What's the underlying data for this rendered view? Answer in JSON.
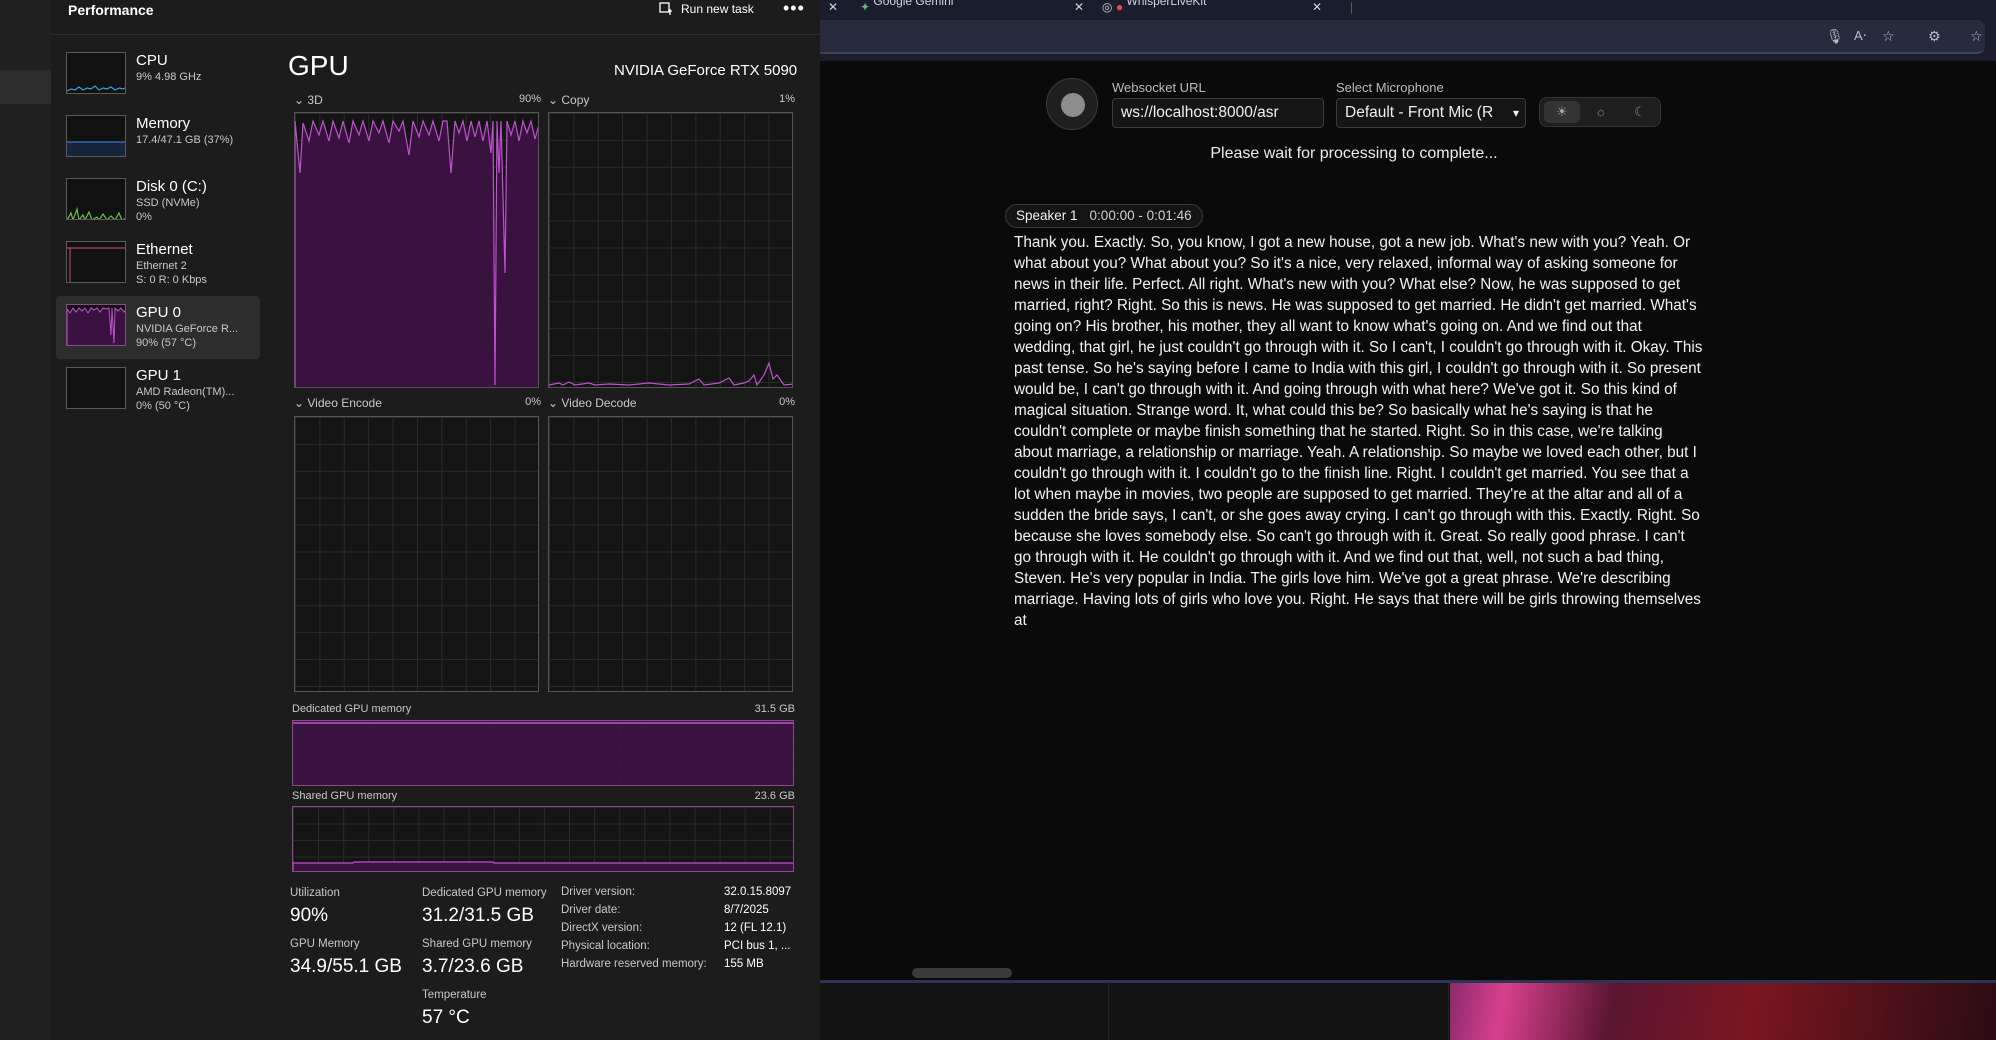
{
  "task_manager": {
    "title": "Performance",
    "run_new_task": "Run new task",
    "more": "•••",
    "sidebar": [
      {
        "name": "CPU",
        "line1": "9% 4.98 GHz",
        "line2": ""
      },
      {
        "name": "Memory",
        "line1": "17.4/47.1 GB (37%)",
        "line2": ""
      },
      {
        "name": "Disk 0 (C:)",
        "line1": "SSD (NVMe)",
        "line2": "0%"
      },
      {
        "name": "Ethernet",
        "line1": "Ethernet 2",
        "line2": "S: 0 R: 0 Kbps"
      },
      {
        "name": "GPU 0",
        "line1": "NVIDIA GeForce R...",
        "line2": "90% (57 °C)"
      },
      {
        "name": "GPU 1",
        "line1": "AMD Radeon(TM)...",
        "line2": "0% (50 °C)"
      }
    ],
    "gpu_title": "GPU",
    "gpu_model": "NVIDIA GeForce RTX 5090",
    "graphs": [
      {
        "label": "3D",
        "value": "90%"
      },
      {
        "label": "Copy",
        "value": "1%"
      },
      {
        "label": "Video Encode",
        "value": "0%"
      },
      {
        "label": "Video Decode",
        "value": "0%"
      }
    ],
    "dedicated_mem": {
      "label": "Dedicated GPU memory",
      "value": "31.5 GB"
    },
    "shared_mem": {
      "label": "Shared GPU memory",
      "value": "23.6 GB"
    },
    "stats": {
      "utilization_label": "Utilization",
      "utilization": "90%",
      "dedicated_label": "Dedicated GPU memory",
      "dedicated": "31.2/31.5 GB",
      "gpu_memory_label": "GPU Memory",
      "gpu_memory": "34.9/55.1 GB",
      "shared_label": "Shared GPU memory",
      "shared": "3.7/23.6 GB",
      "temp_label": "Temperature",
      "temp": "57 °C"
    },
    "info": [
      {
        "k": "Driver version:",
        "v": "32.0.15.8097"
      },
      {
        "k": "Driver date:",
        "v": "8/7/2025"
      },
      {
        "k": "DirectX version:",
        "v": "12 (FL 12.1)"
      },
      {
        "k": "Physical location:",
        "v": "PCI bus 1, ..."
      },
      {
        "k": "Hardware reserved memory:",
        "v": "155 MB"
      }
    ],
    "colors": {
      "gpu_line": "#c050d0",
      "gpu_fill": "#3a1240",
      "cpu_line": "#3aa0d8",
      "disk_line": "#6cc04a",
      "eth_line": "#d04a80"
    }
  },
  "browser": {
    "tabs": [
      {
        "title": "Google Gemini"
      },
      {
        "title": "WhisperLiveKit"
      }
    ],
    "app": {
      "websocket_label": "Websocket URL",
      "websocket_value": "ws://localhost:8000/asr",
      "mic_label": "Select Microphone",
      "mic_value": "Default - Front Mic (R",
      "status": "Please wait for processing to complete...",
      "speaker": "Speaker 1",
      "time_range": "0:00:00 - 0:01:46",
      "transcript": "Thank you. Exactly. So, you know, I got a new house, got a new job. What's new with you? Yeah. Or what about you? What about you? So it's a nice, very relaxed, informal way of asking someone for news in their life. Perfect. All right. What's new with you? What else? Now, he was supposed to get married, right? Right. So this is news. He was supposed to get married. He didn't get married. What's going on? His brother, his mother, they all want to know what's going on. And we find out that wedding, that girl, he just couldn't go through with it. So I can't, I couldn't go through with it. Okay. This past tense. So he's saying before I came to India with this girl, I couldn't go through with it. So present would be, I can't go through with it. And going through with what here? We've got it. So this kind of magical situation. Strange word. It, what could this be? So basically what he's saying is that he couldn't complete or maybe finish something that he started. Right. So in this case, we're talking about marriage, a relationship or marriage. Yeah. A relationship. So maybe we loved each other, but I couldn't go through with it. I couldn't go to the finish line. Right. I couldn't get married. You see that a lot when maybe in movies, two people are supposed to get married. They're at the altar and all of a sudden the bride says, I can't, or she goes away crying. I can't go through with this. Exactly. Right. So because she loves somebody else. So can't go through with it. Great. So really good phrase. I can't go through with it. He couldn't go through with it. And we find out that, well, not such a bad thing, Steven. He's very popular in India. The girls love him. We've got a great phrase. We're describing marriage. Having lots of girls who love you. Right. He says that there will be girls throwing themselves at"
    }
  }
}
